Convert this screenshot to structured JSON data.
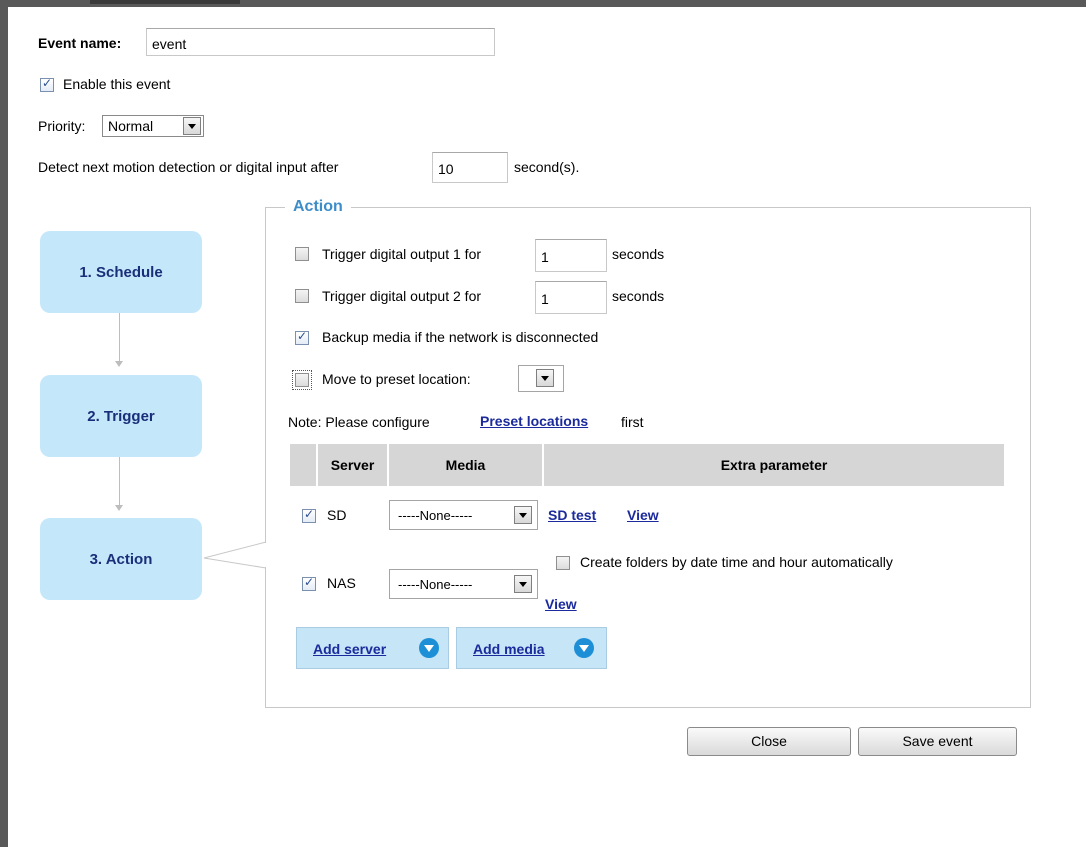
{
  "form": {
    "event_name_label": "Event name:",
    "event_name_value": "event",
    "enable_label": "Enable this event",
    "enable_checked": true,
    "priority_label": "Priority:",
    "priority_value": "Normal",
    "detect_prefix": "Detect next motion detection or digital input after",
    "detect_value": "10",
    "detect_suffix": "second(s)."
  },
  "steps": [
    {
      "label": "1.  Schedule"
    },
    {
      "label": "2.  Trigger"
    },
    {
      "label": "3.  Action"
    }
  ],
  "action": {
    "legend": "Action",
    "do1_label": "Trigger digital output 1 for",
    "do1_value": "1",
    "do1_unit": "seconds",
    "do2_label": "Trigger digital output 2 for",
    "do2_value": "1",
    "do2_unit": "seconds",
    "backup_label": "Backup media if the network is disconnected",
    "backup_checked": true,
    "preset_label": "Move to preset location:",
    "note_prefix": "Note: Please configure",
    "note_link": "Preset locations",
    "note_suffix": "first",
    "table_headers": {
      "server": "Server",
      "media": "Media",
      "extra": "Extra parameter"
    },
    "rows": [
      {
        "server": "SD",
        "checked": true,
        "media": "-----None-----",
        "test_link": "SD test",
        "view_link": "View"
      },
      {
        "server": "NAS",
        "checked": true,
        "media": "-----None-----",
        "folder_label": "Create folders by date time and hour automatically",
        "view_link": "View"
      }
    ],
    "add_server": "Add server",
    "add_media": "Add media"
  },
  "buttons": {
    "close": "Close",
    "save": "Save event"
  }
}
